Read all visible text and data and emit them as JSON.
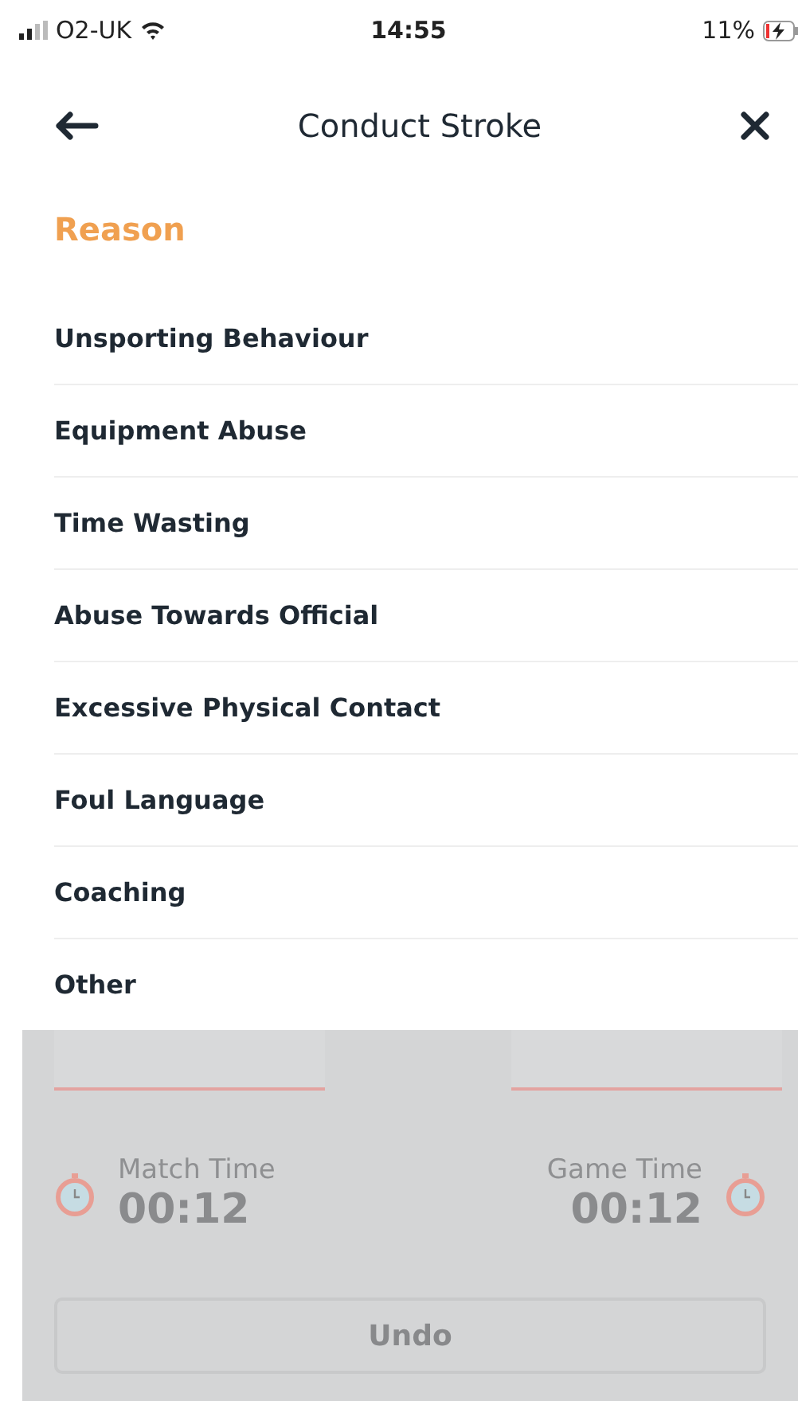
{
  "status_bar": {
    "carrier": "O2-UK",
    "time": "14:55",
    "battery": "11%"
  },
  "header": {
    "title": "Conduct Stroke"
  },
  "section": {
    "title": "Reason"
  },
  "reasons": [
    {
      "label": "Unsporting Behaviour"
    },
    {
      "label": "Equipment Abuse"
    },
    {
      "label": "Time Wasting"
    },
    {
      "label": "Abuse Towards Official"
    },
    {
      "label": "Excessive Physical Contact"
    },
    {
      "label": "Foul Language"
    },
    {
      "label": "Coaching"
    },
    {
      "label": "Other"
    }
  ],
  "background": {
    "timers": [
      {
        "label": "Match Time",
        "value": "00:12"
      },
      {
        "label": "Game Time",
        "value": "00:12"
      }
    ],
    "undo": "Undo"
  }
}
